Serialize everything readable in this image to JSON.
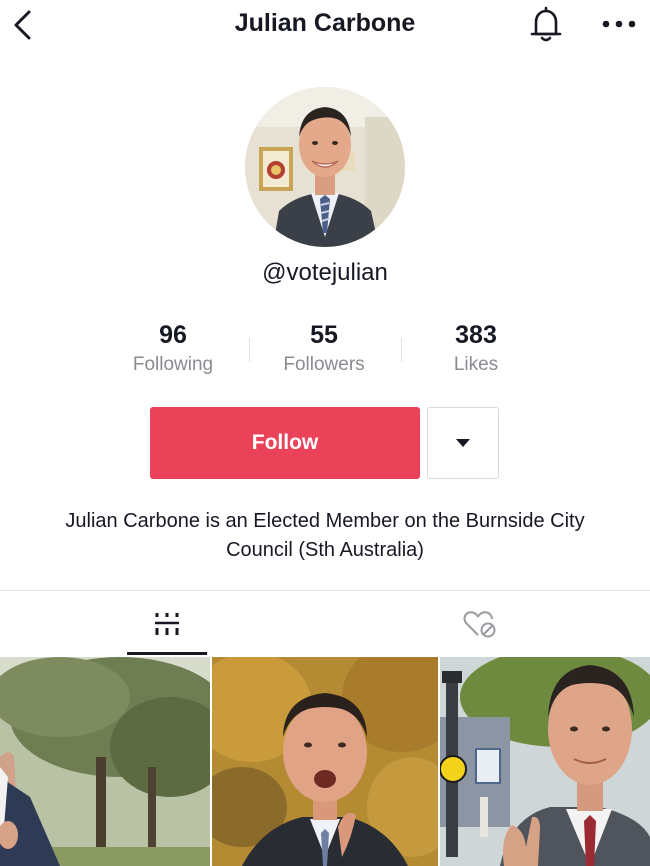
{
  "header": {
    "title": "Julian Carbone",
    "back_icon": "chevron-left-icon",
    "bell_icon": "bell-icon",
    "more_icon": "more-horizontal-icon"
  },
  "profile": {
    "handle": "@votejulian",
    "avatar_icon": "avatar"
  },
  "stats": [
    {
      "value": "96",
      "label": "Following"
    },
    {
      "value": "55",
      "label": "Followers"
    },
    {
      "value": "383",
      "label": "Likes"
    }
  ],
  "actions": {
    "follow_label": "Follow",
    "dropdown_icon": "triangle-down-icon"
  },
  "bio": "Julian Carbone is an Elected Member on the Burnside City Council (Sth Australia)",
  "tabs": [
    {
      "name": "videos",
      "icon": "grid-icon",
      "active": true
    },
    {
      "name": "liked",
      "icon": "private-heart-icon",
      "active": false
    }
  ],
  "colors": {
    "accent": "#ea4359",
    "text": "#161823",
    "muted": "#8a8b91"
  },
  "videos": [
    {
      "scene": "outdoor-trees"
    },
    {
      "scene": "autumn-foliage"
    },
    {
      "scene": "street-sign"
    }
  ]
}
